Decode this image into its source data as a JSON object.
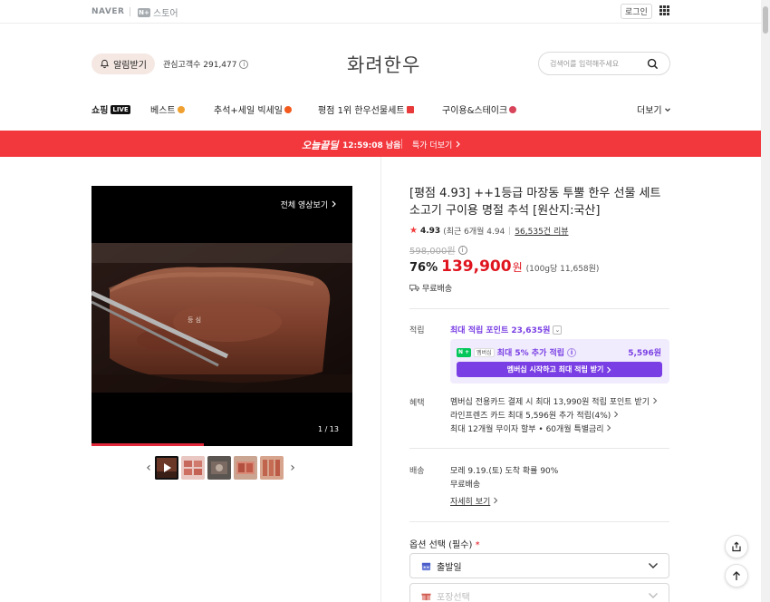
{
  "topbar": {
    "naver": "NAVER",
    "npay_badge": "N+",
    "store": "스토어",
    "login": "로그인"
  },
  "header": {
    "alarm": "알림받기",
    "fans": "관심고객수 291,477",
    "logo": "화려한우",
    "search_placeholder": "검색어를 입력해주세요"
  },
  "nav": {
    "shopping": "쇼핑",
    "live": "LIVE",
    "items": [
      "베스트",
      "추석+세일 빅세일",
      "평점 1위 한우선물세트",
      "구이용&스테이크"
    ],
    "more": "더보기"
  },
  "banner": {
    "today": "오늘끝딜",
    "time": "12:59:08 남음",
    "more": "특가 더보기"
  },
  "media": {
    "all_videos": "전체 영상보기",
    "subtitle": "등 심",
    "counter": "1 / 13",
    "progress": 0.43
  },
  "product": {
    "title": "[평점 4.93] ++1등급 마장동 투뿔 한우 선물 세트 소고기 구이용 명절 추석 [원산지:국산]",
    "score": "4.93",
    "recent": "(최근 6개월 4.94",
    "reviews": "56,535건 리뷰",
    "original_price": "598,000원",
    "discount": "76%",
    "price": "139,900",
    "won": "원",
    "unit_price": "(100g당 11,658원)",
    "free_shipping": "무료배송"
  },
  "points": {
    "label": "적립",
    "max": "최대 적립 포인트 23,635원",
    "npay": "N +",
    "member": "멤버십",
    "extra": "최대 5% 추가 적립",
    "extra_amount": "5,596원",
    "cta": "멤버십 시작하고 최대 적립 받기"
  },
  "benefits": {
    "label": "혜택",
    "items": [
      "멤버십 전용카드 결제 시 최대 13,990원 적립 포인트 받기",
      "라인프렌즈 카드 최대 5,596원 추가 적립(4%)",
      "최대 12개월 무이자 할부 • 60개월 특별금리"
    ]
  },
  "shipping": {
    "label": "배송",
    "arrival": "모레 9.19.(토) 도착 확률 90%",
    "fee": "무료배송",
    "detail": "자세히 보기"
  },
  "options": {
    "label": "옵션 선택 (필수)",
    "required_mark": "*",
    "select1": "출발일",
    "select2": "포장선택"
  },
  "colors": {
    "accent": "#f2373d",
    "price": "#e0141e",
    "membership": "#7a3fe4"
  }
}
